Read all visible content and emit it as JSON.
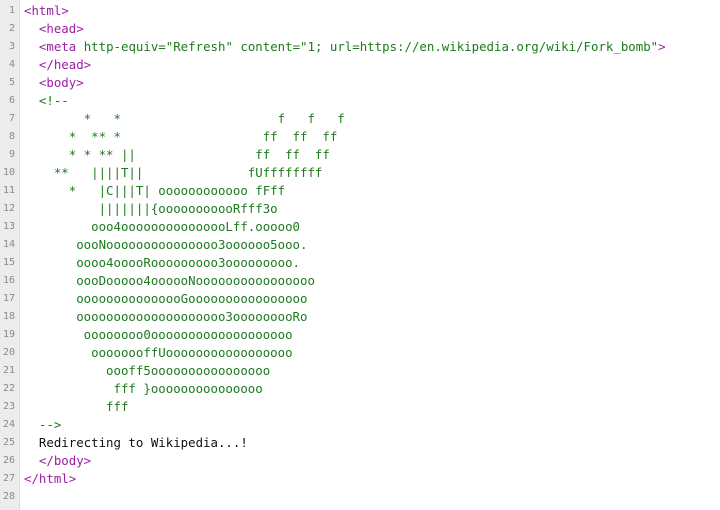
{
  "colors": {
    "tag": "#9c1fa3",
    "attribute": "#1f7a1f",
    "comment": "#1f7a1f",
    "text": "#111111",
    "gutter_bg": "#ececec",
    "line_number": "#8a8a8a"
  },
  "line_numbers": [
    "1",
    "2",
    "3",
    "4",
    "5",
    "6",
    "7",
    "8",
    "9",
    "10",
    "11",
    "12",
    "13",
    "14",
    "15",
    "16",
    "17",
    "18",
    "19",
    "20",
    "21",
    "22",
    "23",
    "24",
    "25",
    "26",
    "27",
    "28"
  ],
  "code": {
    "l1": "<html>",
    "l2": "  <head>",
    "l3_indent": "  ",
    "l3_open": "<meta",
    "l3_attr1": " http-equiv=",
    "l3_val1": "\"Refresh\"",
    "l3_attr2": " content=",
    "l3_val2": "\"1; url=https://en.wikipedia.org/wiki/Fork_bomb\"",
    "l3_close": ">",
    "l4": "  </head>",
    "l5": "  <body>",
    "l6": "  <!--",
    "art": [
      "        *   *                     f   f   f",
      "      *  ** *                   ff  ff  ff",
      "      * * ** ||                ff  ff  ff",
      "    **   ||||T||              fUffffffff",
      "      *   |C|||T| oooooooooooo fFff",
      "          |||||||{ooooooooooRfff3o",
      "         ooo4ooooooooooooooLff.ooooo0",
      "       oooNooooooooooooooo3oooooo5ooo.",
      "       oooo4ooooRooooooooo3ooooooooo.",
      "       oooDooooo4oooooNoooooooooooooooo",
      "       ooooooooooooooGoooooooooooooooo",
      "       oooooooooooooooooooo3ooooooooRo",
      "        oooooooo0ooooooooooooooooooo",
      "         oooooooffUooooooooooooooooo",
      "           oooff5oooooooooooooooo",
      "            fff }ooooooooooooooo",
      "           fff"
    ],
    "l24": "  -->",
    "l25": "  Redirecting to Wikipedia...!",
    "l26": "  </body>",
    "l27": "</html>",
    "l28": ""
  }
}
